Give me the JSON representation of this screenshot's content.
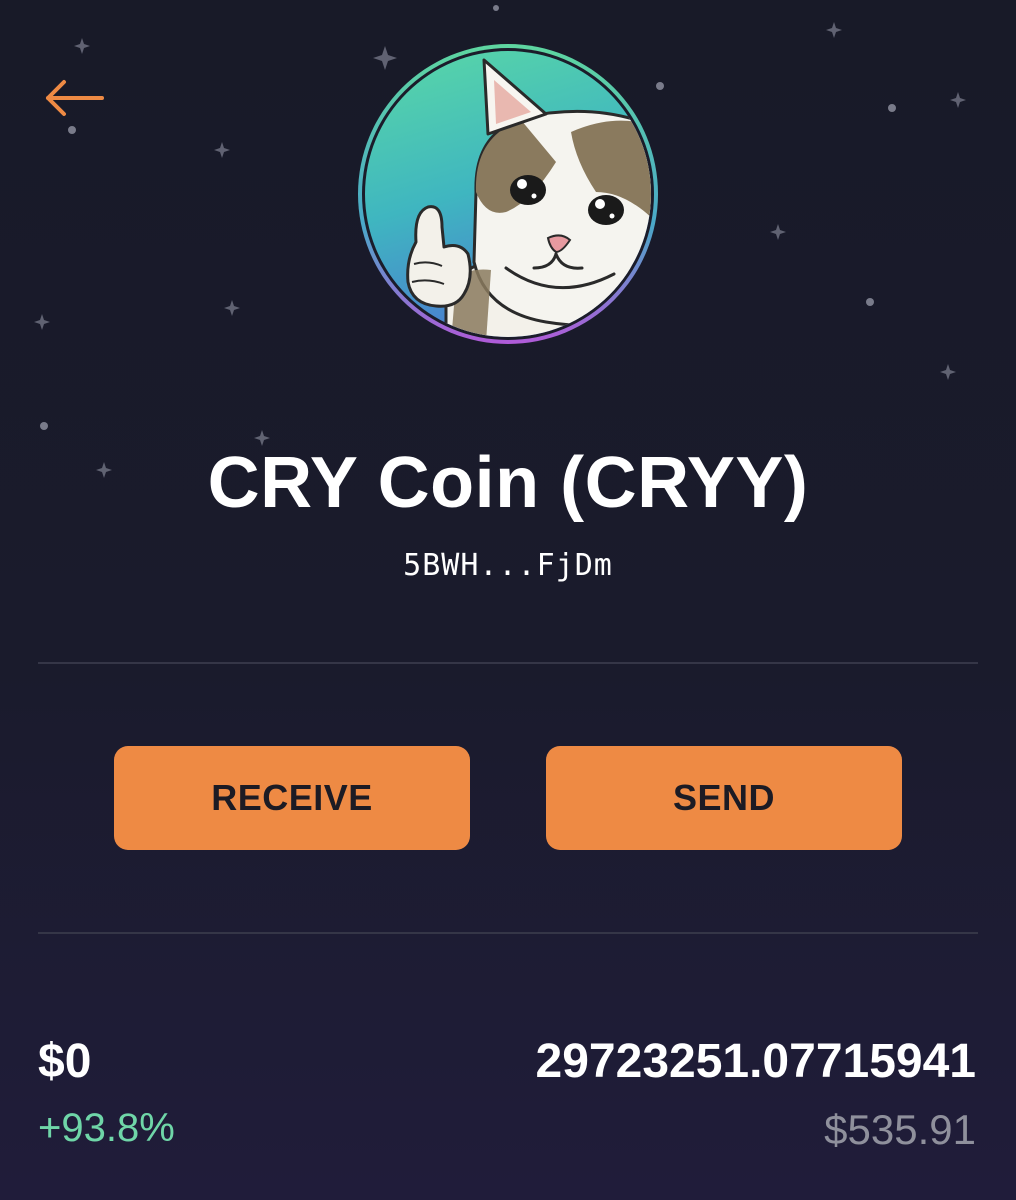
{
  "header": {
    "back_icon": "arrow-left-icon",
    "accent_color": "#ee8a44"
  },
  "token": {
    "name": "CRY Coin (CRYY)",
    "address": "5BWH...FjDm",
    "avatar_icon": "thumbs-up-cat-icon"
  },
  "actions": {
    "receive_label": "RECEIVE",
    "send_label": "SEND",
    "button_color": "#ee8a44"
  },
  "balance": {
    "usd_value": "$0",
    "change": "+93.8%",
    "change_color": "#6fd6a8",
    "amount": "29723251.07715941",
    "amount_value": "$535.91"
  }
}
